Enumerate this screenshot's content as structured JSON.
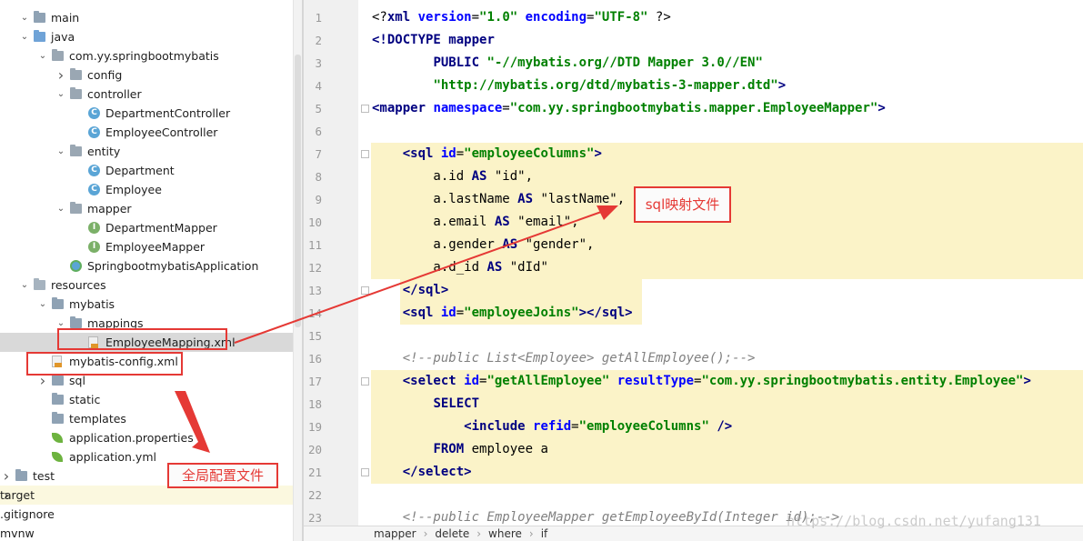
{
  "tree": {
    "items": [
      {
        "label": "main",
        "arrow": "v",
        "icon": "folder",
        "icon_name": "folder-icon"
      },
      {
        "label": "java",
        "arrow": "v",
        "icon": "folder-src",
        "icon_name": "source-folder-icon"
      },
      {
        "label": "com.yy.springbootmybatis",
        "arrow": "v",
        "icon": "pkg",
        "icon_name": "package-icon"
      },
      {
        "label": "config",
        "arrow": ">",
        "icon": "pkg",
        "icon_name": "package-icon"
      },
      {
        "label": "controller",
        "arrow": "v",
        "icon": "pkg",
        "icon_name": "package-icon"
      },
      {
        "label": "DepartmentController",
        "arrow": "",
        "icon": "class",
        "icon_name": "class-icon"
      },
      {
        "label": "EmployeeController",
        "arrow": "",
        "icon": "class",
        "icon_name": "class-icon"
      },
      {
        "label": "entity",
        "arrow": "v",
        "icon": "pkg",
        "icon_name": "package-icon"
      },
      {
        "label": "Department",
        "arrow": "",
        "icon": "class",
        "icon_name": "class-icon"
      },
      {
        "label": "Employee",
        "arrow": "",
        "icon": "class",
        "icon_name": "class-icon"
      },
      {
        "label": "mapper",
        "arrow": "v",
        "icon": "pkg",
        "icon_name": "package-icon"
      },
      {
        "label": "DepartmentMapper",
        "arrow": "",
        "icon": "iface",
        "icon_name": "interface-icon"
      },
      {
        "label": "EmployeeMapper",
        "arrow": "",
        "icon": "iface",
        "icon_name": "interface-icon"
      },
      {
        "label": "SpringbootmybatisApplication",
        "arrow": "",
        "icon": "app",
        "icon_name": "spring-boot-app-icon"
      },
      {
        "label": "resources",
        "arrow": "v",
        "icon": "folder-res",
        "icon_name": "resources-folder-icon"
      },
      {
        "label": "mybatis",
        "arrow": "v",
        "icon": "folder",
        "icon_name": "folder-icon"
      },
      {
        "label": "mappings",
        "arrow": "v",
        "icon": "folder",
        "icon_name": "folder-icon"
      },
      {
        "label": "EmployeeMapping.xml",
        "arrow": "",
        "icon": "xml",
        "icon_name": "xml-file-icon"
      },
      {
        "label": "mybatis-config.xml",
        "arrow": "",
        "icon": "xml",
        "icon_name": "xml-file-icon"
      },
      {
        "label": "sql",
        "arrow": ">",
        "icon": "folder",
        "icon_name": "folder-icon"
      },
      {
        "label": "static",
        "arrow": "",
        "icon": "folder",
        "icon_name": "folder-icon"
      },
      {
        "label": "templates",
        "arrow": "",
        "icon": "folder",
        "icon_name": "folder-icon"
      },
      {
        "label": "application.properties",
        "arrow": "",
        "icon": "leaf",
        "icon_name": "spring-properties-icon"
      },
      {
        "label": "application.yml",
        "arrow": "",
        "icon": "leaf",
        "icon_name": "spring-yml-icon"
      },
      {
        "label": "test",
        "arrow": ">",
        "icon": "folder",
        "icon_name": "folder-icon"
      },
      {
        "label": "target",
        "arrow": ">",
        "icon": "none",
        "icon_name": ""
      },
      {
        "label": ".gitignore",
        "arrow": "",
        "icon": "none",
        "icon_name": ""
      },
      {
        "label": "mvnw",
        "arrow": "",
        "icon": "none",
        "icon_name": ""
      }
    ]
  },
  "editor": {
    "line_numbers": [
      "1",
      "2",
      "3",
      "4",
      "5",
      "6",
      "7",
      "8",
      "9",
      "10",
      "11",
      "12",
      "13",
      "14",
      "15",
      "16",
      "17",
      "18",
      "19",
      "20",
      "21",
      "22",
      "23"
    ],
    "lines": [
      [
        {
          "c": "tx",
          "t": "<?"
        },
        {
          "c": "tg",
          "t": "xml "
        },
        {
          "c": "an",
          "t": "version"
        },
        {
          "c": "tx",
          "t": "="
        },
        {
          "c": "av",
          "t": "\"1.0\" "
        },
        {
          "c": "an",
          "t": "encoding"
        },
        {
          "c": "tx",
          "t": "="
        },
        {
          "c": "av",
          "t": "\"UTF-8\""
        },
        {
          "c": "tx",
          "t": " ?>"
        }
      ],
      [
        {
          "c": "tg",
          "t": "<!DOCTYPE "
        },
        {
          "c": "tg",
          "t": "mapper"
        }
      ],
      [
        {
          "c": "tx",
          "t": "        "
        },
        {
          "c": "tg",
          "t": "PUBLIC "
        },
        {
          "c": "av",
          "t": "\"-//mybatis.org//DTD Mapper 3.0//EN\""
        }
      ],
      [
        {
          "c": "tx",
          "t": "        "
        },
        {
          "c": "av",
          "t": "\"http://mybatis.org/dtd/mybatis-3-mapper.dtd\""
        },
        {
          "c": "tg",
          "t": ">"
        }
      ],
      [
        {
          "c": "tg",
          "t": "<mapper "
        },
        {
          "c": "an",
          "t": "namespace"
        },
        {
          "c": "tx",
          "t": "="
        },
        {
          "c": "av",
          "t": "\"com.yy.springbootmybatis.mapper.EmployeeMapper\""
        },
        {
          "c": "tg",
          "t": ">"
        }
      ],
      [],
      [
        {
          "c": "tx",
          "t": "    "
        },
        {
          "c": "tg",
          "t": "<sql "
        },
        {
          "c": "an",
          "t": "id"
        },
        {
          "c": "tx",
          "t": "="
        },
        {
          "c": "av",
          "t": "\"employeeColumns\""
        },
        {
          "c": "tg",
          "t": ">"
        }
      ],
      [
        {
          "c": "tx",
          "t": "        a.id "
        },
        {
          "c": "kw",
          "t": "AS "
        },
        {
          "c": "tx",
          "t": "\"id\","
        }
      ],
      [
        {
          "c": "tx",
          "t": "        a.lastName "
        },
        {
          "c": "kw",
          "t": "AS "
        },
        {
          "c": "tx",
          "t": "\"lastName\","
        }
      ],
      [
        {
          "c": "tx",
          "t": "        a.email "
        },
        {
          "c": "kw",
          "t": "AS "
        },
        {
          "c": "tx",
          "t": "\"email\","
        }
      ],
      [
        {
          "c": "tx",
          "t": "        a.gender "
        },
        {
          "c": "kw",
          "t": "AS "
        },
        {
          "c": "tx",
          "t": "\"gender\","
        }
      ],
      [
        {
          "c": "tx",
          "t": "        a.d_id "
        },
        {
          "c": "kw",
          "t": "AS "
        },
        {
          "c": "tx",
          "t": "\"dId\""
        }
      ],
      [
        {
          "c": "tx",
          "t": "    "
        },
        {
          "c": "tg",
          "t": "</sql>"
        }
      ],
      [
        {
          "c": "tx",
          "t": "    "
        },
        {
          "c": "tg",
          "t": "<sql "
        },
        {
          "c": "an",
          "t": "id"
        },
        {
          "c": "tx",
          "t": "="
        },
        {
          "c": "av",
          "t": "\"employeeJoins\""
        },
        {
          "c": "tg",
          "t": "></sql>"
        }
      ],
      [],
      [
        {
          "c": "cm",
          "t": "    <!--public List<Employee> getAllEmployee();-->"
        }
      ],
      [
        {
          "c": "tx",
          "t": "    "
        },
        {
          "c": "tg",
          "t": "<select "
        },
        {
          "c": "an",
          "t": "id"
        },
        {
          "c": "tx",
          "t": "="
        },
        {
          "c": "av",
          "t": "\"getAllEmployee\" "
        },
        {
          "c": "an",
          "t": "resultType"
        },
        {
          "c": "tx",
          "t": "="
        },
        {
          "c": "av",
          "t": "\"com.yy.springbootmybatis.entity.Employee\""
        },
        {
          "c": "tg",
          "t": ">"
        }
      ],
      [
        {
          "c": "tx",
          "t": "        "
        },
        {
          "c": "kw",
          "t": "SELECT"
        }
      ],
      [
        {
          "c": "tx",
          "t": "            "
        },
        {
          "c": "tg",
          "t": "<include "
        },
        {
          "c": "an",
          "t": "refid"
        },
        {
          "c": "tx",
          "t": "="
        },
        {
          "c": "av",
          "t": "\"employeeColumns\" "
        },
        {
          "c": "tg",
          "t": "/>"
        }
      ],
      [
        {
          "c": "tx",
          "t": "        "
        },
        {
          "c": "kw",
          "t": "FROM "
        },
        {
          "c": "tx",
          "t": "employee a"
        }
      ],
      [
        {
          "c": "tx",
          "t": "    "
        },
        {
          "c": "tg",
          "t": "</select>"
        }
      ],
      [],
      [
        {
          "c": "cm",
          "t": "    <!--public EmployeeMapper getEmployeeById(Integer id);-->"
        }
      ]
    ],
    "breadcrumb": [
      "mapper",
      "delete",
      "where",
      "if"
    ]
  },
  "annotations": {
    "sql_mapping_label": "sql映射文件",
    "global_config_label": "全局配置文件",
    "color": "#e53935"
  },
  "watermark": "https://blog.csdn.net/yufang131"
}
